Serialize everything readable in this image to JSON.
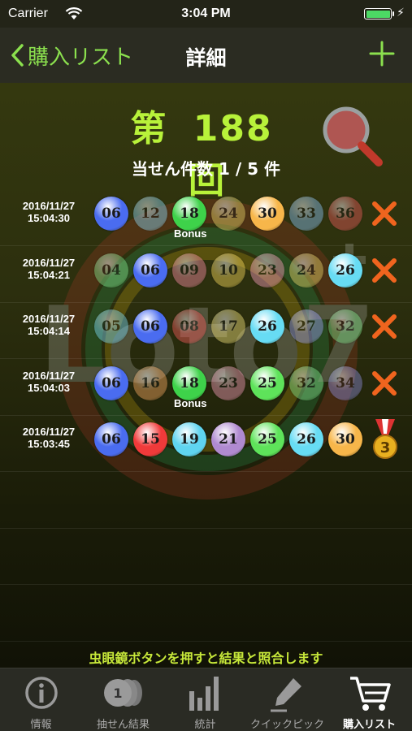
{
  "status_bar": {
    "carrier": "Carrier",
    "time": "3:04 PM"
  },
  "nav": {
    "back_label": "購入リスト",
    "title": "詳細"
  },
  "draw": {
    "prefix": "第",
    "number": "188",
    "suffix": "回"
  },
  "win_count": "当せん件数 1 / 5 件",
  "watermark_text": "Loto7",
  "rows": [
    {
      "date": "2016/11/27",
      "time": "15:04:30",
      "balls": [
        {
          "n": "06",
          "hit": true
        },
        {
          "n": "12",
          "hit": false
        },
        {
          "n": "18",
          "hit": true,
          "bonus": true
        },
        {
          "n": "24",
          "hit": false
        },
        {
          "n": "30",
          "hit": true
        },
        {
          "n": "33",
          "hit": false
        },
        {
          "n": "36",
          "hit": false
        }
      ],
      "bonus_label": "Bonus",
      "result": "lose"
    },
    {
      "date": "2016/11/27",
      "time": "15:04:21",
      "balls": [
        {
          "n": "04",
          "hit": false
        },
        {
          "n": "06",
          "hit": true
        },
        {
          "n": "09",
          "hit": false
        },
        {
          "n": "10",
          "hit": false
        },
        {
          "n": "23",
          "hit": false
        },
        {
          "n": "24",
          "hit": false
        },
        {
          "n": "26",
          "hit": true
        }
      ],
      "result": "lose"
    },
    {
      "date": "2016/11/27",
      "time": "15:04:14",
      "balls": [
        {
          "n": "05",
          "hit": false
        },
        {
          "n": "06",
          "hit": true
        },
        {
          "n": "08",
          "hit": false
        },
        {
          "n": "17",
          "hit": false
        },
        {
          "n": "26",
          "hit": true
        },
        {
          "n": "27",
          "hit": false
        },
        {
          "n": "32",
          "hit": false
        }
      ],
      "result": "lose"
    },
    {
      "date": "2016/11/27",
      "time": "15:04:03",
      "balls": [
        {
          "n": "06",
          "hit": true
        },
        {
          "n": "16",
          "hit": false
        },
        {
          "n": "18",
          "hit": true,
          "bonus": true
        },
        {
          "n": "23",
          "hit": false
        },
        {
          "n": "25",
          "hit": true
        },
        {
          "n": "32",
          "hit": false
        },
        {
          "n": "34",
          "hit": false
        }
      ],
      "bonus_label": "Bonus",
      "result": "lose"
    },
    {
      "date": "2016/11/27",
      "time": "15:03:45",
      "balls": [
        {
          "n": "06",
          "hit": true
        },
        {
          "n": "15",
          "hit": true
        },
        {
          "n": "19",
          "hit": true
        },
        {
          "n": "21",
          "hit": true
        },
        {
          "n": "25",
          "hit": true
        },
        {
          "n": "26",
          "hit": true
        },
        {
          "n": "30",
          "hit": true
        }
      ],
      "result": "win",
      "prize": "3"
    }
  ],
  "hint": "虫眼鏡ボタンを押すと結果と照合します",
  "tabs": [
    {
      "label": "情報",
      "icon": "info-icon"
    },
    {
      "label": "抽せん結果",
      "icon": "coins-icon"
    },
    {
      "label": "統計",
      "icon": "bar-chart-icon"
    },
    {
      "label": "クイックピック",
      "icon": "pencil-icon"
    },
    {
      "label": "購入リスト",
      "icon": "cart-icon",
      "active": true
    }
  ],
  "colors": {
    "accent_green": "#8be04e",
    "title_green": "#b8f23a",
    "x_orange": "#f0641e"
  }
}
